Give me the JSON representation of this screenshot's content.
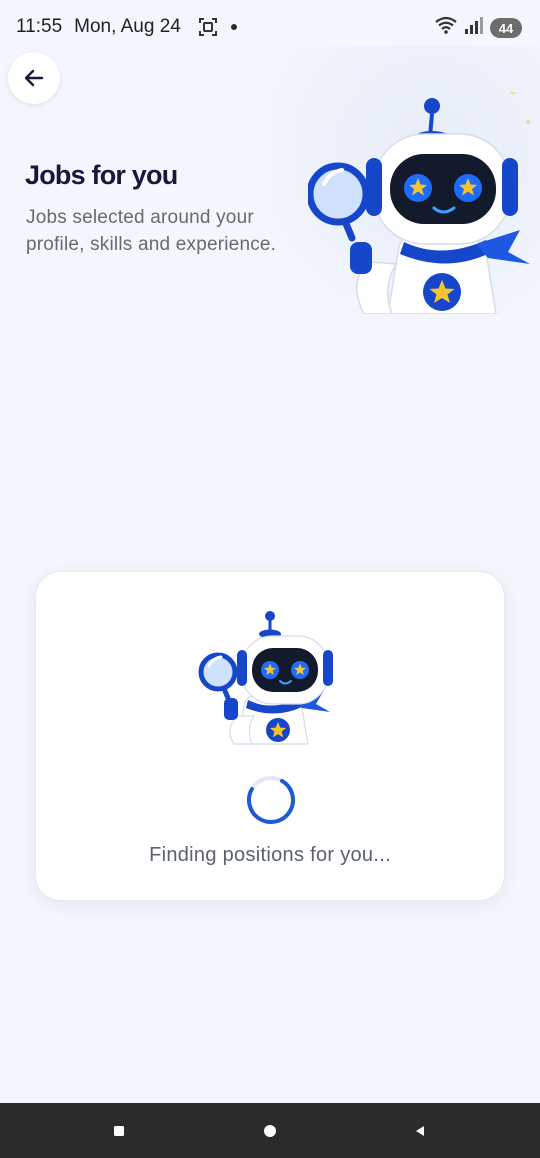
{
  "status_bar": {
    "time": "11:55",
    "date": "Mon, Aug 24",
    "battery": "44",
    "icons": [
      "screenshot-icon",
      "notification-dot-icon",
      "wifi-icon",
      "signal-icon",
      "battery-icon"
    ]
  },
  "header": {
    "back_icon": "arrow-left-icon",
    "title": "Jobs for you",
    "subtitle": "Jobs selected around your profile, skills and experience."
  },
  "loading": {
    "message": "Finding positions for you...",
    "spinner": "loading-spinner"
  },
  "nav": {
    "icons": [
      "recents-icon",
      "home-icon",
      "back-icon"
    ]
  },
  "colors": {
    "background": "#f3f6fc",
    "title": "#141a3c",
    "accent": "#1f5ad6",
    "robot_blue": "#1646c9",
    "nav_bar": "#2b2b2d"
  }
}
